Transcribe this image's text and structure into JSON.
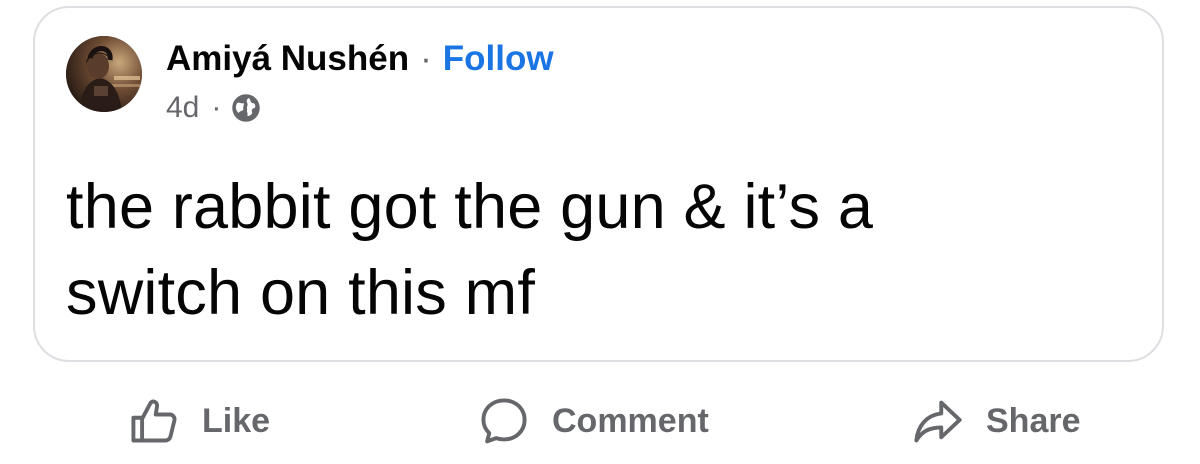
{
  "post": {
    "author": {
      "name": "Amiyá Nushén",
      "separator": "·",
      "follow_label": "Follow"
    },
    "meta": {
      "age": "4d",
      "separator": "·",
      "privacy_icon": "globe-icon"
    },
    "text_line_1": "the rabbit got the gun & it’s a",
    "text_line_2": "switch on this mf"
  },
  "actions": {
    "like_label": "Like",
    "comment_label": "Comment",
    "share_label": "Share"
  },
  "colors": {
    "accent": "#1b74e4",
    "text": "#050505",
    "secondary_text": "#65676b",
    "card_border": "#dddfe2"
  }
}
